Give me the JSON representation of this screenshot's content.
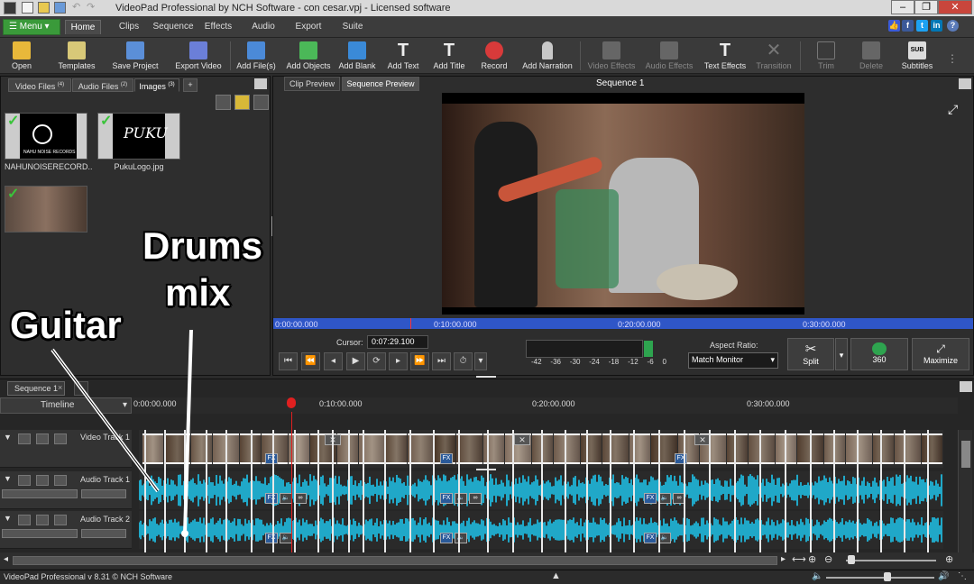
{
  "window": {
    "title": "VideoPad Professional by NCH Software - con cesar.vpj - Licensed software"
  },
  "menubar": {
    "menu_label": "Menu",
    "tabs": [
      "Home",
      "Clips",
      "Sequence",
      "Effects",
      "Audio",
      "Export",
      "Suite"
    ],
    "active_tab": "Home"
  },
  "toolbar": {
    "items": [
      {
        "label": "Open",
        "color": "#e8b83a"
      },
      {
        "label": "Templates",
        "color": "#d8c878"
      },
      {
        "label": "Save Project",
        "color": "#5b8fd8"
      },
      {
        "label": "Export Video",
        "color": "#6b7fd8"
      },
      {
        "label": "Add File(s)",
        "color": "#4b8ad8"
      },
      {
        "label": "Add Objects",
        "color": "#4bb858"
      },
      {
        "label": "Add Blank",
        "color": "#3a8ad8"
      },
      {
        "label": "Add Text",
        "color": "#e8e8e8"
      },
      {
        "label": "Add Title",
        "color": "#e8e8e8"
      },
      {
        "label": "Record",
        "color": "#d83a3a"
      },
      {
        "label": "Add Narration",
        "color": "#c8c8c8"
      },
      {
        "label": "Video Effects",
        "color": "#777777"
      },
      {
        "label": "Audio Effects",
        "color": "#777777"
      },
      {
        "label": "Text Effects",
        "color": "#e8e8e8"
      },
      {
        "label": "Transition",
        "color": "#777777"
      },
      {
        "label": "Trim",
        "color": "#777777"
      },
      {
        "label": "Delete",
        "color": "#777777"
      },
      {
        "label": "Subtitles",
        "color": "#e8e8e8"
      }
    ]
  },
  "media_panel": {
    "tabs": [
      {
        "label": "Video Files",
        "count": "(4)"
      },
      {
        "label": "Audio Files",
        "count": "(2)"
      },
      {
        "label": "Images",
        "count": "(3)"
      }
    ],
    "add_tab": "+",
    "thumbs": [
      {
        "label": "NAHUNOISERECORD...",
        "logo_text": "NAHU NOISE RECORDS"
      },
      {
        "label": "PukuLogo.jpg",
        "logo_text": "PUKU"
      },
      {
        "label": ""
      }
    ]
  },
  "annotations": {
    "drums_line1": "Drums",
    "drums_line2": "mix",
    "guitar": "Guitar"
  },
  "preview": {
    "tabs": [
      "Clip Preview",
      "Sequence Preview"
    ],
    "active_tab": "Sequence Preview",
    "title": "Sequence 1",
    "times": [
      "0:00:00.000",
      "0:10:00.000",
      "0:20:00.000",
      "0:30:00.000"
    ],
    "cursor_label": "Cursor:",
    "cursor_value": "0:07:29.100",
    "meter_ticks": [
      "-42",
      "-36",
      "-30",
      "-24",
      "-18",
      "-12",
      "-6",
      "0"
    ],
    "aspect_label": "Aspect Ratio:",
    "aspect_value": "Match Monitor",
    "split_label": "Split",
    "vr_label": "360",
    "maximize_label": "Maximize"
  },
  "timeline": {
    "seq_tab": "Sequence 1",
    "label": "Timeline",
    "ruler": [
      "0:00:00.000",
      "0:10:00.000",
      "0:20:00.000",
      "0:30:00.000"
    ],
    "tracks": [
      "Video Track 1",
      "Audio Track 1",
      "Audio Track 2"
    ],
    "fx_label": "FX"
  },
  "status": {
    "text": "VideoPad Professional v 8.31 © NCH Software"
  }
}
